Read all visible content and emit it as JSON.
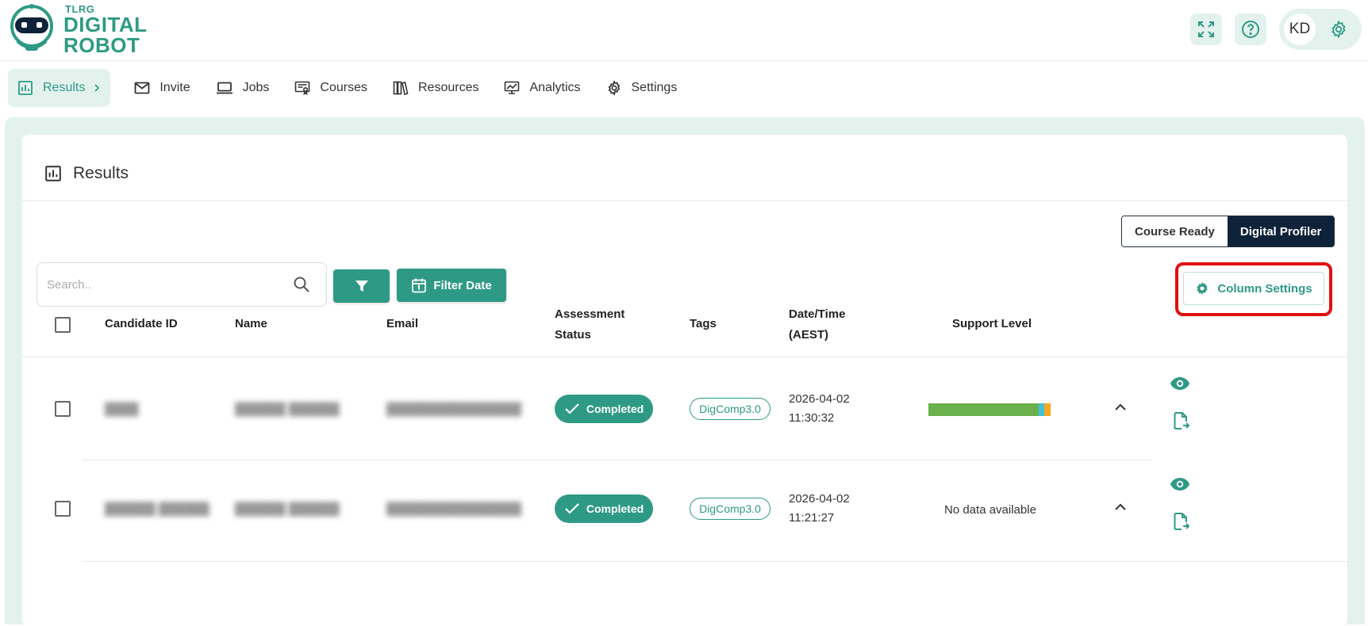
{
  "brand": {
    "small": "TLRG",
    "line1": "DIGITAL",
    "line2": "ROBOT",
    "color": "#2e9a85"
  },
  "header": {
    "icons": [
      "fullscreen-icon",
      "help-icon",
      "gear-icon"
    ],
    "user_initials": "KD"
  },
  "nav": {
    "items": [
      {
        "label": "Results",
        "icon": "bar-chart-icon",
        "active": true
      },
      {
        "label": "Invite",
        "icon": "mail-icon"
      },
      {
        "label": "Jobs",
        "icon": "laptop-icon"
      },
      {
        "label": "Courses",
        "icon": "certificate-icon"
      },
      {
        "label": "Resources",
        "icon": "books-icon"
      },
      {
        "label": "Analytics",
        "icon": "monitor-chart-icon"
      },
      {
        "label": "Settings",
        "icon": "gear-icon"
      }
    ]
  },
  "page": {
    "title": "Results"
  },
  "toggle": {
    "options": [
      "Course Ready",
      "Digital Profiler"
    ],
    "selected": "Digital Profiler"
  },
  "toolbar": {
    "search_placeholder": "Search..",
    "filter_date_label": "Filter Date",
    "column_settings_label": "Column Settings"
  },
  "table": {
    "columns": {
      "candidate_id": "Candidate ID",
      "name": "Name",
      "email": "Email",
      "status_line1": "Assessment",
      "status_line2": "Status",
      "tags": "Tags",
      "datetime_line1": "Date/Time",
      "datetime_line2": "(AEST)",
      "support_level": "Support Level"
    },
    "rows": [
      {
        "status": "Completed",
        "tag": "DigComp3.0",
        "date": "2026-04-02",
        "time": "11:30:32",
        "support_level": {
          "segments": [
            {
              "fraction": 0.9,
              "color": "#6ab04c"
            },
            {
              "fraction": 0.05,
              "color": "#3fc1d8"
            },
            {
              "fraction": 0.05,
              "color": "#f5a623"
            }
          ]
        }
      },
      {
        "status": "Completed",
        "tag": "DigComp3.0",
        "date": "2026-04-02",
        "time": "11:21:27",
        "support_level_text": "No data available"
      }
    ]
  },
  "colors": {
    "accent": "#2e9a85",
    "accent_light": "#e4f2ee",
    "dark": "#0e2339",
    "highlight": "#e01010"
  }
}
